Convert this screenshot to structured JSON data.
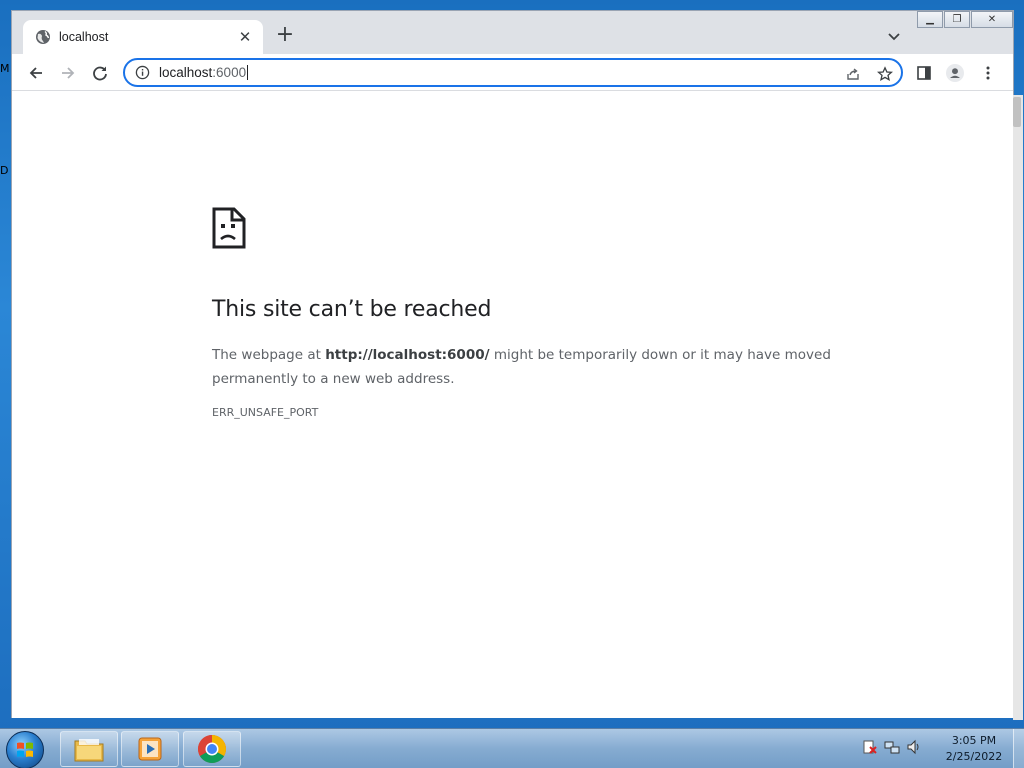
{
  "desktop": {
    "edge_labels": [
      "M",
      "D"
    ]
  },
  "tab": {
    "title": "localhost"
  },
  "omnibox": {
    "url_host": "localhost",
    "url_port": ":6000"
  },
  "error": {
    "title": "This site can’t be reached",
    "body_prefix": "The webpage at ",
    "body_url": "http://localhost:6000/",
    "body_suffix": " might be temporarily down or it may have moved permanently to a new web address.",
    "code": "ERR_UNSAFE_PORT"
  },
  "taskbar": {
    "apps": [
      "file-explorer",
      "media-player",
      "chrome"
    ],
    "time": "3:05 PM",
    "date": "2/25/2022"
  },
  "colors": {
    "accent": "#1a73e8",
    "toolbar_bg": "#dee1e6",
    "content_bg": "#ffffff"
  }
}
